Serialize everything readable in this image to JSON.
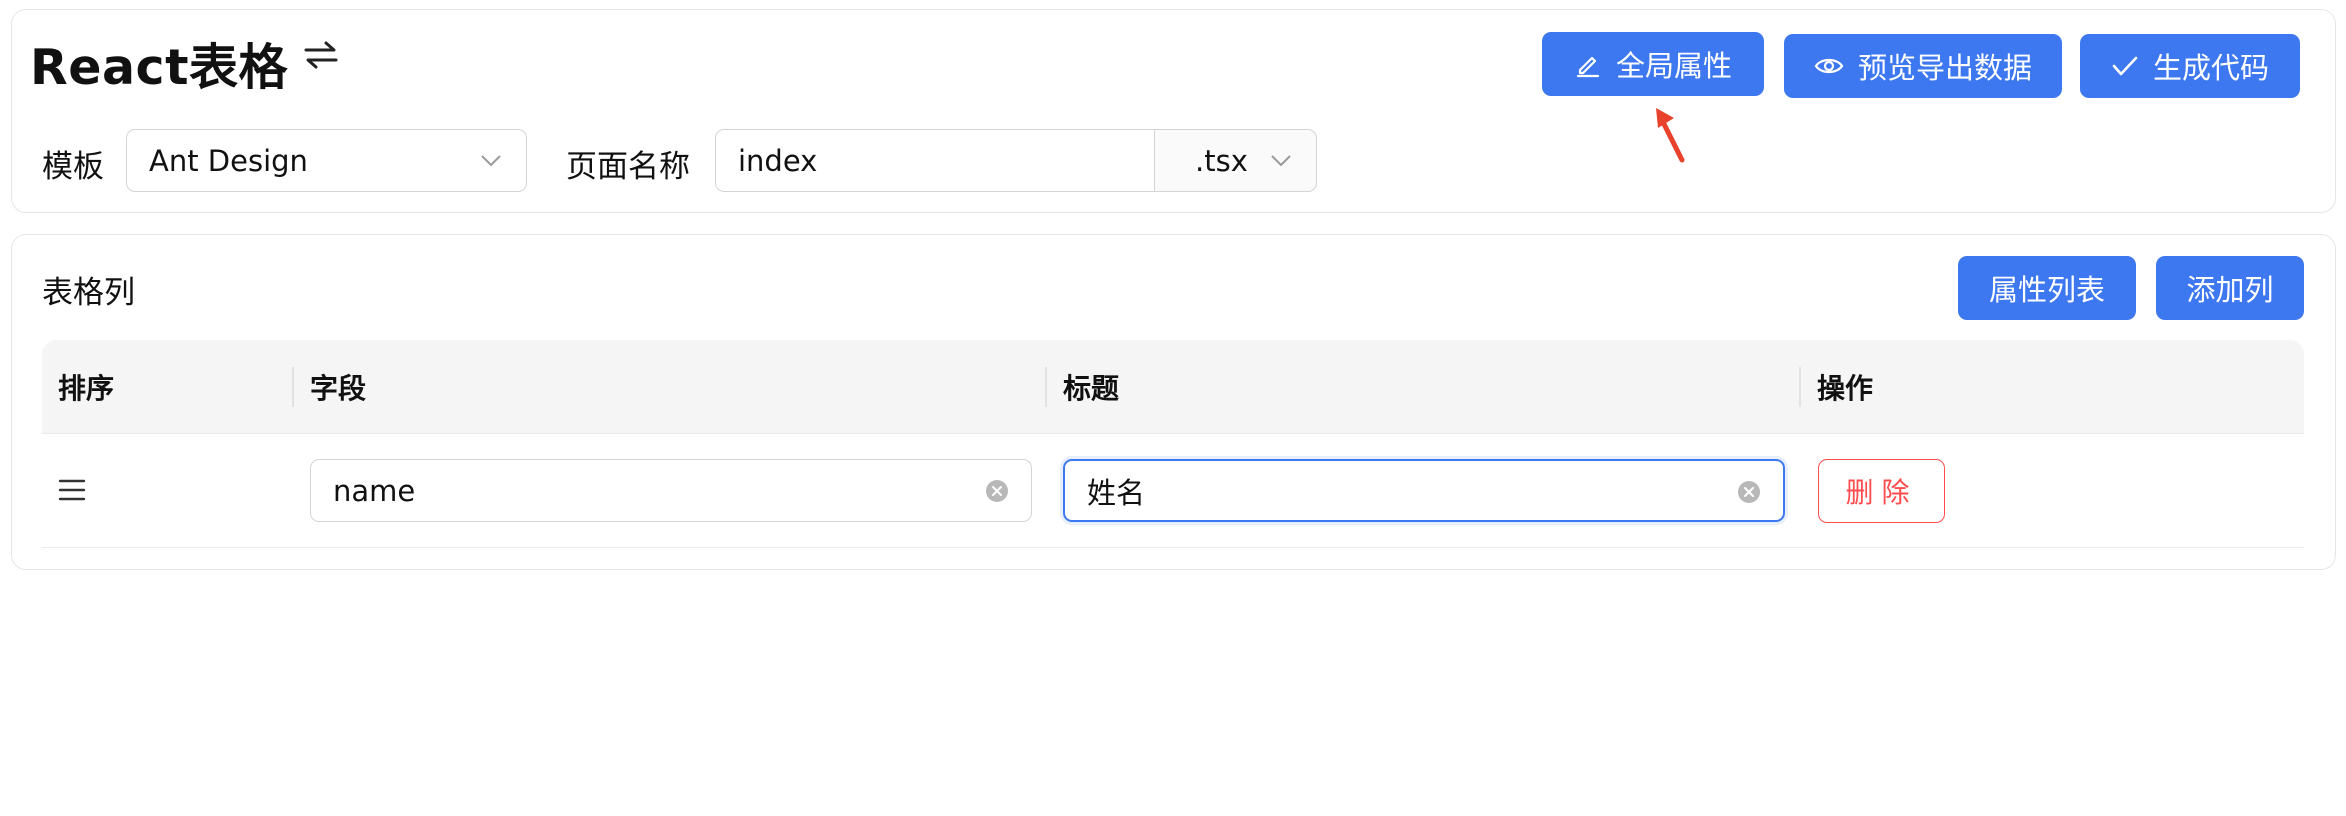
{
  "header": {
    "title": "React表格",
    "switch_icon": "swap-arrows-icon"
  },
  "toolbar": {
    "global_props_label": "全局属性",
    "preview_label": "预览导出数据",
    "generate_label": "生成代码",
    "accent_color": "#3d78f0"
  },
  "form": {
    "template_label": "模板",
    "template_value": "Ant Design",
    "page_name_label": "页面名称",
    "page_name_value": "index",
    "extension_value": ".tsx"
  },
  "columns_section": {
    "title": "表格列",
    "attr_list_label": "属性列表",
    "add_column_label": "添加列"
  },
  "table": {
    "headers": [
      "排序",
      "字段",
      "标题",
      "操作"
    ],
    "rows": [
      {
        "field": "name",
        "title": "姓名",
        "action": "删除"
      }
    ]
  },
  "annotations": {
    "arrow_color": "#e8412c"
  }
}
